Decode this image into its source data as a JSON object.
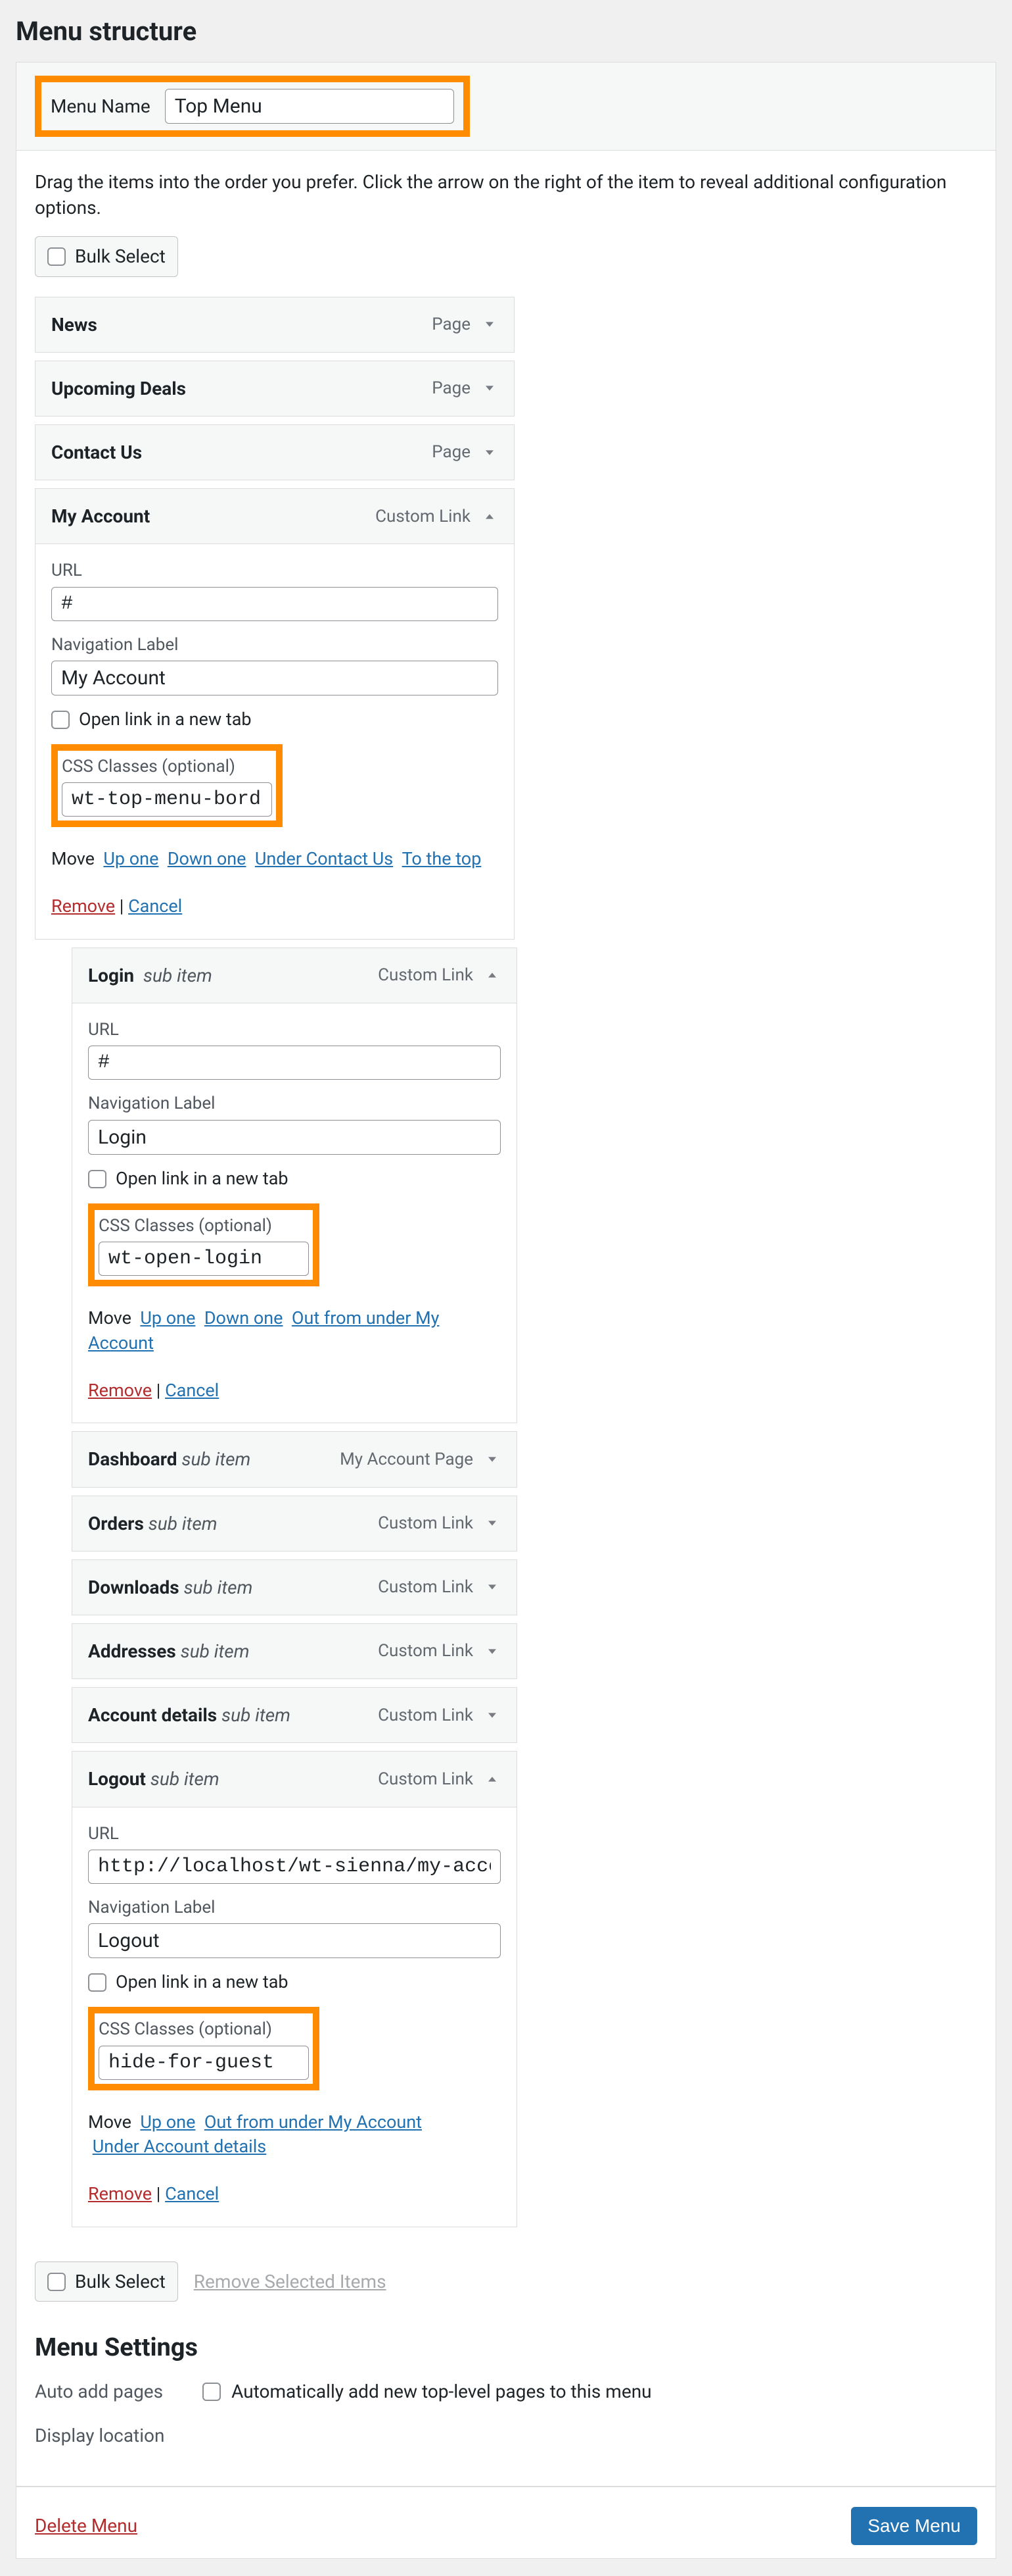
{
  "heading": "Menu structure",
  "menuNameLabel": "Menu Name",
  "menuNameValue": "Top Menu",
  "dragHint": "Drag the items into the order you prefer. Click the arrow on the right of the item to reveal additional configuration options.",
  "bulkSelect": "Bulk Select",
  "removeSelected": "Remove Selected Items",
  "items": {
    "news": {
      "title": "News",
      "type": "Page"
    },
    "upcoming": {
      "title": "Upcoming Deals",
      "type": "Page"
    },
    "contact": {
      "title": "Contact Us",
      "type": "Page"
    },
    "myaccount": {
      "title": "My Account",
      "type": "Custom Link",
      "url": "#",
      "navLabel": "My Account",
      "openNewTab": "Open link in a new tab",
      "cssLabel": "CSS Classes (optional)",
      "cssValue": "wt-top-menu-bordered",
      "moveText": "Move",
      "moveUpOne": "Up one",
      "moveDownOne": "Down one",
      "moveUnder": "Under Contact Us",
      "moveTop": "To the top",
      "remove": "Remove",
      "cancel": "Cancel"
    },
    "login": {
      "title": "Login",
      "sub": "sub item",
      "type": "Custom Link",
      "url": "#",
      "navLabel": "Login",
      "openNewTab": "Open link in a new tab",
      "cssLabel": "CSS Classes (optional)",
      "cssValue": "wt-open-login",
      "moveText": "Move",
      "moveUpOne": "Up one",
      "moveDownOne": "Down one",
      "moveOut": "Out from under My Account",
      "remove": "Remove",
      "cancel": "Cancel"
    },
    "dashboard": {
      "title": "Dashboard",
      "sub": "sub item",
      "type": "My Account Page"
    },
    "orders": {
      "title": "Orders",
      "sub": "sub item",
      "type": "Custom Link"
    },
    "downloads": {
      "title": "Downloads",
      "sub": "sub item",
      "type": "Custom Link"
    },
    "addresses": {
      "title": "Addresses",
      "sub": "sub item",
      "type": "Custom Link"
    },
    "accountdetails": {
      "title": "Account details",
      "sub": "sub item",
      "type": "Custom Link"
    },
    "logout": {
      "title": "Logout",
      "sub": "sub item",
      "type": "Custom Link",
      "url": "http://localhost/wt-sienna/my-account/custome",
      "navLabel": "Logout",
      "openNewTab": "Open link in a new tab",
      "cssLabel": "CSS Classes (optional)",
      "cssValue": "hide-for-guest",
      "moveText": "Move",
      "moveUpOne": "Up one",
      "moveOut": "Out from under My Account",
      "moveUnder": "Under Account details",
      "remove": "Remove",
      "cancel": "Cancel"
    }
  },
  "labels": {
    "url": "URL",
    "navLabel": "Navigation Label"
  },
  "settingsHeading": "Menu Settings",
  "autoAddLabel": "Auto add pages",
  "autoAddCheck": "Automatically add new top-level pages to this menu",
  "displayLocation": "Display location",
  "deleteMenu": "Delete Menu",
  "saveMenu": "Save Menu"
}
